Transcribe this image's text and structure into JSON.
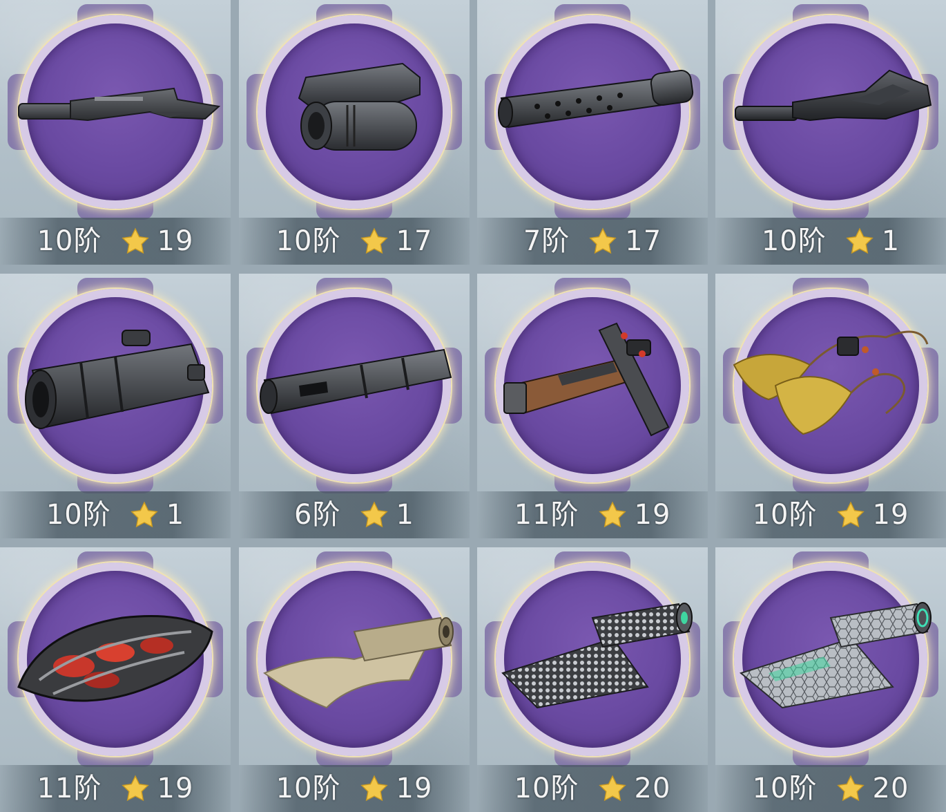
{
  "colors": {
    "disc": "#6a4aa2",
    "ring_glow": "#f0e2b2",
    "star": "#f3c84a",
    "label_text": "#f4f4f4"
  },
  "items": [
    {
      "grade": "10阶",
      "stars": "19",
      "icon": "rifle-stock-icon"
    },
    {
      "grade": "10阶",
      "stars": "17",
      "icon": "laser-sight-icon"
    },
    {
      "grade": "7阶",
      "stars": "17",
      "icon": "silencer-icon"
    },
    {
      "grade": "10阶",
      "stars": "1",
      "icon": "tactical-stock-icon"
    },
    {
      "grade": "10阶",
      "stars": "1",
      "icon": "scope-icon"
    },
    {
      "grade": "6阶",
      "stars": "1",
      "icon": "muzzle-brake-icon"
    },
    {
      "grade": "11阶",
      "stars": "19",
      "icon": "grip-icon"
    },
    {
      "grade": "10阶",
      "stars": "19",
      "icon": "tassel-icon"
    },
    {
      "grade": "11阶",
      "stars": "19",
      "icon": "armor-plate-icon"
    },
    {
      "grade": "10阶",
      "stars": "19",
      "icon": "cloth-roll-icon"
    },
    {
      "grade": "10阶",
      "stars": "20",
      "icon": "chain-mesh-roll-icon"
    },
    {
      "grade": "10阶",
      "stars": "20",
      "icon": "hex-fabric-roll-icon"
    }
  ]
}
